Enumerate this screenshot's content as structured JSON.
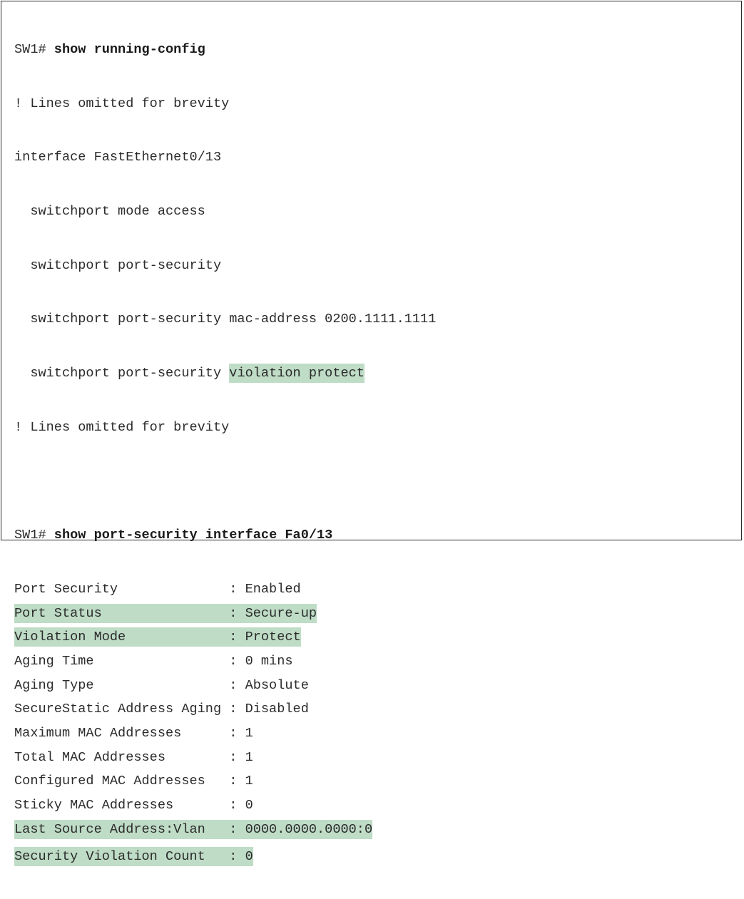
{
  "config_section": {
    "prompt": "SW1# ",
    "command": "show running-config",
    "lines": [
      "! Lines omitted for brevity",
      "interface FastEthernet0/13",
      "  switchport mode access",
      "  switchport port-security",
      "  switchport port-security mac-address 0200.1111.1111"
    ],
    "violation_prefix": "  switchport port-security ",
    "violation_highlight": "violation protect",
    "trailer": "! Lines omitted for brevity"
  },
  "status_section": {
    "prompt": "SW1# ",
    "command": "show port-security interface Fa0/13",
    "rows": [
      {
        "text": "Port Security              : Enabled",
        "highlight": false
      },
      {
        "text": "Port Status                : Secure-up",
        "highlight": true
      },
      {
        "text": "Violation Mode             : Protect",
        "highlight": true
      },
      {
        "text": "Aging Time                 : 0 mins",
        "highlight": false
      },
      {
        "text": "Aging Type                 : Absolute",
        "highlight": false
      },
      {
        "text": "SecureStatic Address Aging : Disabled",
        "highlight": false
      },
      {
        "text": "Maximum MAC Addresses      : 1",
        "highlight": false
      },
      {
        "text": "Total MAC Addresses        : 1",
        "highlight": false
      },
      {
        "text": "Configured MAC Addresses   : 1",
        "highlight": false
      },
      {
        "text": "Sticky MAC Addresses       : 0",
        "highlight": false
      },
      {
        "text": "Last Source Address:Vlan   : 0000.0000.0000:0",
        "highlight": true
      },
      {
        "text": "Security Violation Count   : 0",
        "highlight": true
      }
    ]
  },
  "colors": {
    "highlight": "#bfdcc6",
    "border": "#2a2a2a",
    "text": "#2b2b2b"
  }
}
